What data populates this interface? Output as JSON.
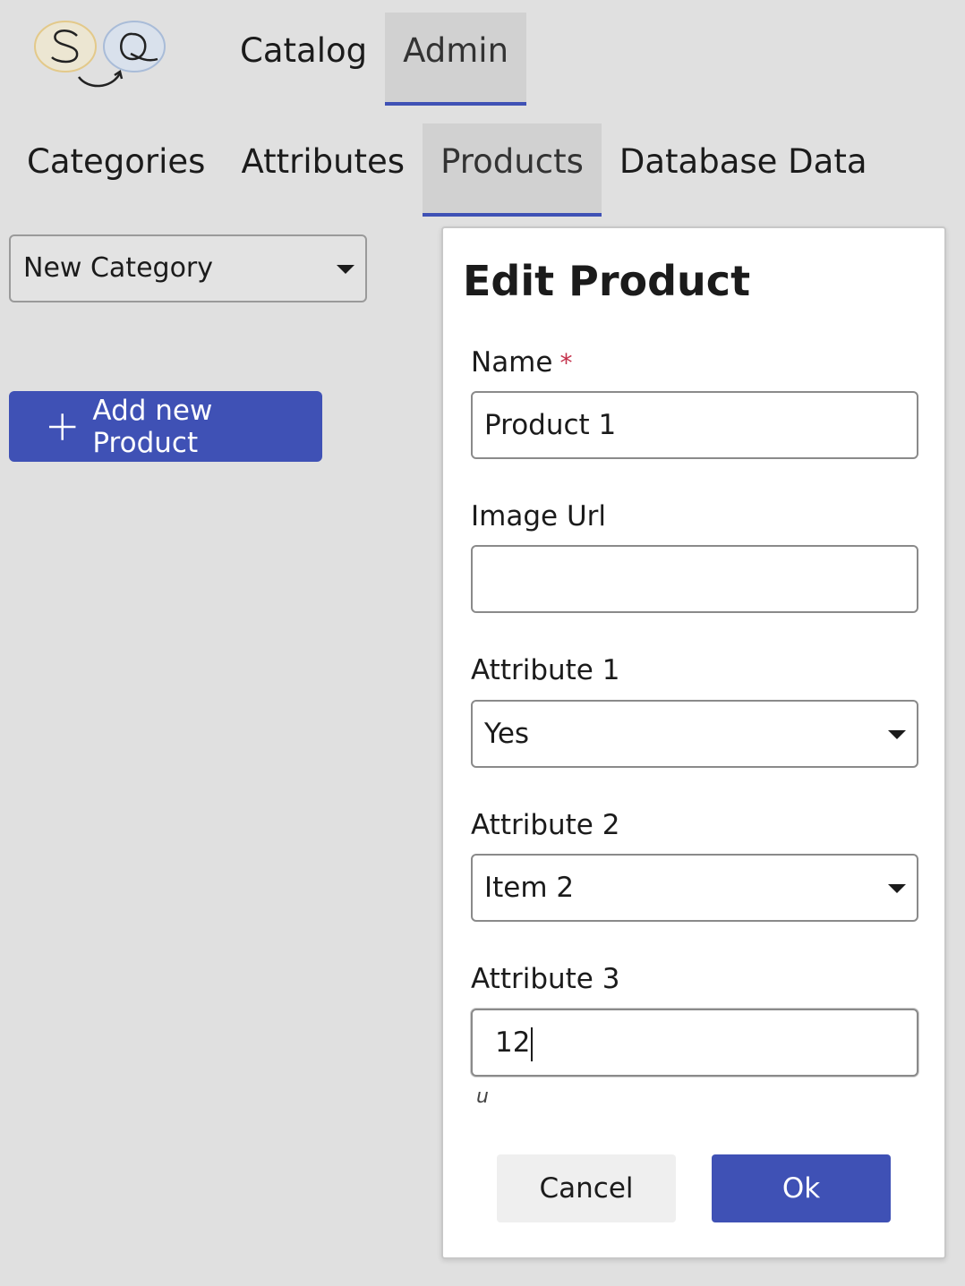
{
  "topnav": {
    "tabs": [
      {
        "label": "Catalog"
      },
      {
        "label": "Admin",
        "active": true
      }
    ]
  },
  "subnav": {
    "tabs": [
      {
        "label": "Categories"
      },
      {
        "label": "Attributes"
      },
      {
        "label": "Products",
        "active": true
      },
      {
        "label": "Database Data"
      }
    ]
  },
  "category_select": {
    "value": "New Category"
  },
  "add_button": {
    "label": "Add new Product"
  },
  "dialog": {
    "title": "Edit Product",
    "fields": {
      "name": {
        "label": "Name",
        "required_mark": "*",
        "value": "Product 1"
      },
      "image_url": {
        "label": "Image Url",
        "value": ""
      },
      "attribute1": {
        "label": "Attribute 1",
        "value": "Yes"
      },
      "attribute2": {
        "label": "Attribute 2",
        "value": "Item 2"
      },
      "attribute3": {
        "label": "Attribute 3",
        "value": "12",
        "unit_hint": "u"
      }
    },
    "cancel_label": "Cancel",
    "ok_label": "Ok"
  },
  "colors": {
    "accent": "#3f51b5",
    "background": "#e0e0e0",
    "required": "#c4314b"
  }
}
